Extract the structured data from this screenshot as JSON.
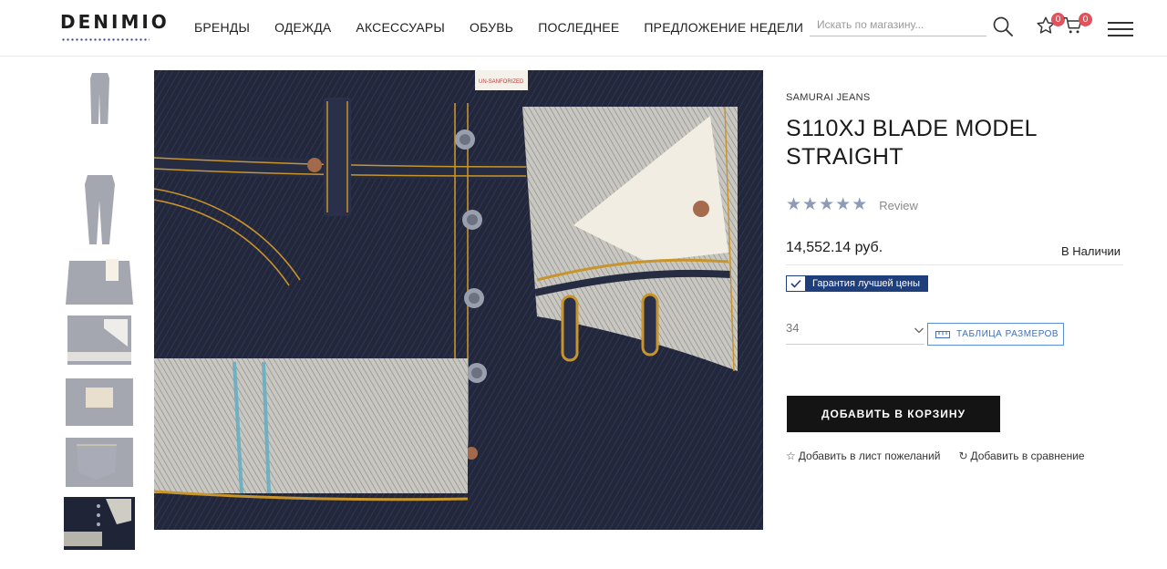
{
  "header": {
    "logo": "DENIMIO",
    "nav": [
      {
        "label": "БРЕНДЫ"
      },
      {
        "label": "ОДЕЖДА"
      },
      {
        "label": "АКСЕССУАРЫ"
      },
      {
        "label": "ОБУВЬ"
      },
      {
        "label": "ПОСЛЕДНЕЕ"
      },
      {
        "label": "ПРЕДЛОЖЕНИЕ НЕДЕЛИ"
      }
    ],
    "search": {
      "placeholder": "Искать по магазину..."
    },
    "wishlist_count": "0",
    "cart_count": "0"
  },
  "gallery": {
    "thumbnails": [
      {
        "icon": "jeans-front-full-thumb"
      },
      {
        "icon": "jeans-back-full-thumb"
      },
      {
        "icon": "jeans-waist-label-thumb"
      },
      {
        "icon": "jeans-fly-closeup-thumb"
      },
      {
        "icon": "jeans-leather-patch-thumb"
      },
      {
        "icon": "jeans-pocket-thumb"
      },
      {
        "icon": "jeans-button-fly-thumb",
        "active": true
      }
    ],
    "main_image_label": "UN-SANFORIZED"
  },
  "product": {
    "brand": "SAMURAI JEANS",
    "title": "S110XJ BLADE MODEL STRAIGHT",
    "rating_stars": 5,
    "review_label": "Review",
    "price": "14,552.14 руб.",
    "stock": "В Наличии",
    "guarantee": "Гарантия лучшей цены",
    "size_selected": "34",
    "size_table_label": "ТАБЛИЦА РАЗМЕРОВ",
    "add_to_cart": "ДОБАВИТЬ В КОРЗИНУ",
    "wishlist_label": "Добавить в лист пожеланий",
    "compare_label": "Добавить в сравнение"
  },
  "colors": {
    "accent_blue": "#1f3e7c",
    "badge_red": "#e2525a",
    "star_grey_blue": "#8c9bb8",
    "button_dark": "#141414",
    "denim_indigo": "#1e2335"
  }
}
